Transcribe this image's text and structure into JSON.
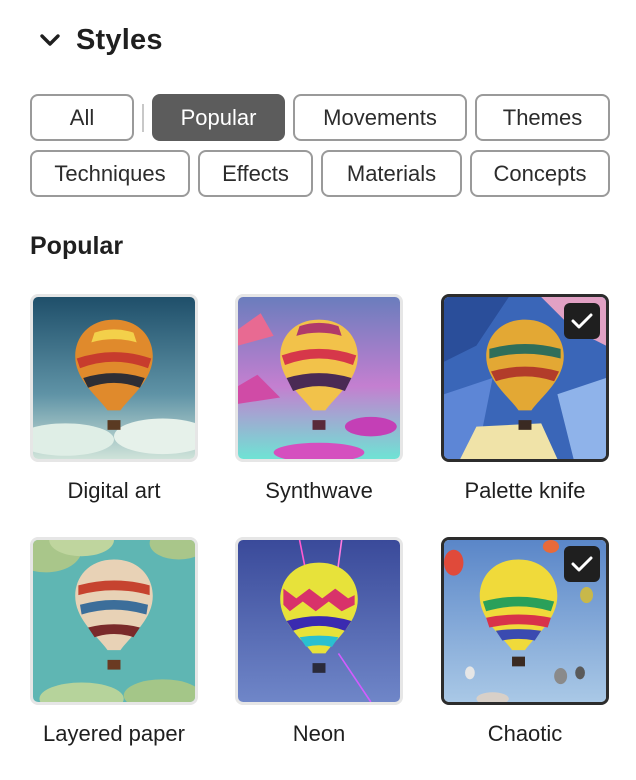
{
  "header": {
    "title": "Styles",
    "toggle_icon": "chevron-down-icon"
  },
  "filters": [
    {
      "label": "All",
      "active": false
    },
    {
      "label": "Popular",
      "active": true
    },
    {
      "label": "Movements",
      "active": false
    },
    {
      "label": "Themes",
      "active": false
    },
    {
      "label": "Techniques",
      "active": false
    },
    {
      "label": "Effects",
      "active": false
    },
    {
      "label": "Materials",
      "active": false
    },
    {
      "label": "Concepts",
      "active": false
    }
  ],
  "section": {
    "title": "Popular"
  },
  "styles": [
    {
      "label": "Digital art",
      "selected": false,
      "thumbnail": "hot-air-balloon-digital-art"
    },
    {
      "label": "Synthwave",
      "selected": false,
      "thumbnail": "hot-air-balloon-synthwave"
    },
    {
      "label": "Palette knife",
      "selected": true,
      "thumbnail": "hot-air-balloon-palette-knife"
    },
    {
      "label": "Layered paper",
      "selected": false,
      "thumbnail": "hot-air-balloon-layered-paper"
    },
    {
      "label": "Neon",
      "selected": false,
      "thumbnail": "hot-air-balloon-neon"
    },
    {
      "label": "Chaotic",
      "selected": true,
      "thumbnail": "hot-air-balloon-chaotic"
    }
  ],
  "colors": {
    "active_chip": "#5c5c5c",
    "selected_border": "#2c2c2c",
    "check_badge": "#1f1f1f"
  }
}
